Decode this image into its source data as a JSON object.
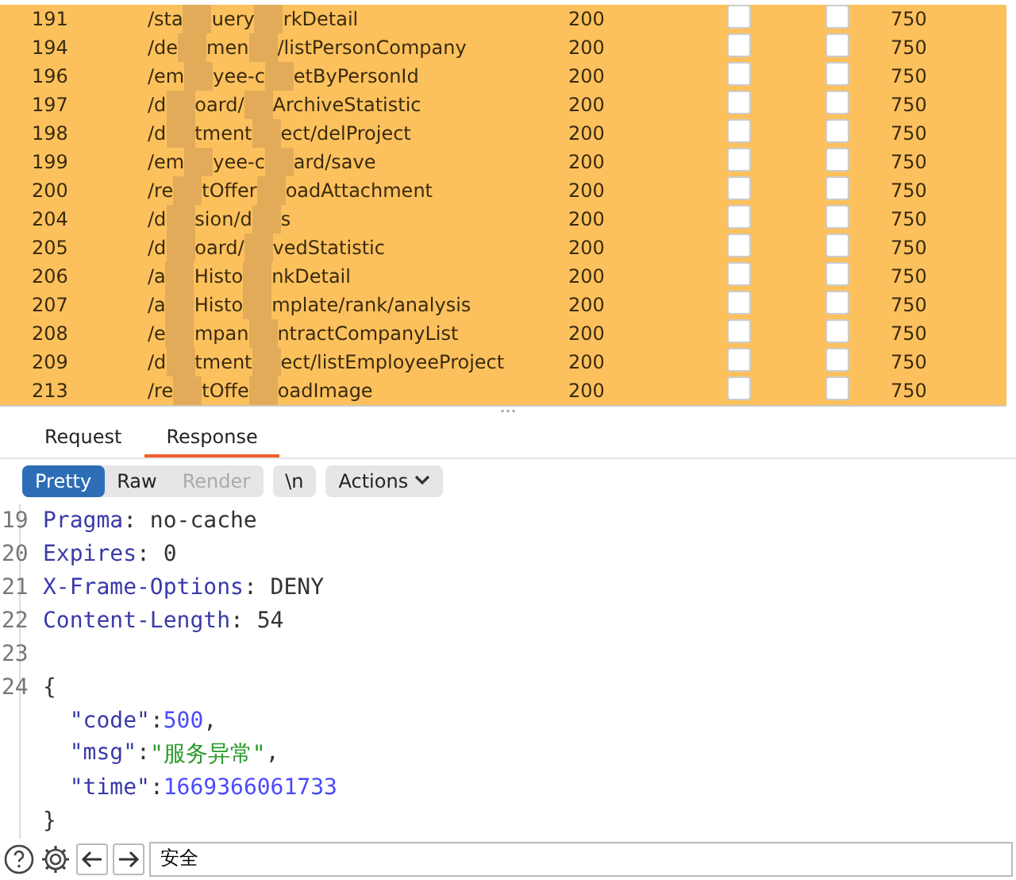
{
  "table": {
    "rows": [
      {
        "number": "191",
        "path": [
          "/sta",
          "uery",
          "rkDetail"
        ],
        "status": "200",
        "check_1": false,
        "check_2": false,
        "length": "750"
      },
      {
        "number": "194",
        "path": [
          "/de",
          "men",
          "/listPersonCompany"
        ],
        "status": "200",
        "check_1": false,
        "check_2": false,
        "length": "750"
      },
      {
        "number": "196",
        "path": [
          "/em",
          "yee-c",
          "etByPersonId"
        ],
        "status": "200",
        "check_1": false,
        "check_2": false,
        "length": "750"
      },
      {
        "number": "197",
        "path": [
          "/d",
          "oard/",
          "ArchiveStatistic"
        ],
        "status": "200",
        "check_1": false,
        "check_2": false,
        "length": "750"
      },
      {
        "number": "198",
        "path": [
          "/d",
          "tment",
          "ect/delProject"
        ],
        "status": "200",
        "check_1": false,
        "check_2": false,
        "length": "750"
      },
      {
        "number": "199",
        "path": [
          "/em",
          "yee-c",
          "ard/save"
        ],
        "status": "200",
        "check_1": false,
        "check_2": false,
        "length": "750"
      },
      {
        "number": "200",
        "path": [
          "/re",
          "tOffer",
          "oadAttachment"
        ],
        "status": "200",
        "check_1": false,
        "check_2": false,
        "length": "750"
      },
      {
        "number": "204",
        "path": [
          "/d",
          "sion/d",
          "s"
        ],
        "status": "200",
        "check_1": false,
        "check_2": false,
        "length": "750"
      },
      {
        "number": "205",
        "path": [
          "/d",
          "oard/",
          "vedStatistic"
        ],
        "status": "200",
        "check_1": false,
        "check_2": false,
        "length": "750"
      },
      {
        "number": "206",
        "path": [
          "/a",
          "Histo",
          "nkDetail"
        ],
        "status": "200",
        "check_1": false,
        "check_2": false,
        "length": "750"
      },
      {
        "number": "207",
        "path": [
          "/a",
          "Histo",
          "mplate/rank/analysis"
        ],
        "status": "200",
        "check_1": false,
        "check_2": false,
        "length": "750"
      },
      {
        "number": "208",
        "path": [
          "/e",
          "mpan",
          "ntractCompanyList"
        ],
        "status": "200",
        "check_1": false,
        "check_2": false,
        "length": "750"
      },
      {
        "number": "209",
        "path": [
          "/d",
          "tment",
          "ect/listEmployeeProject"
        ],
        "status": "200",
        "check_1": false,
        "check_2": false,
        "length": "750"
      },
      {
        "number": "213",
        "path": [
          "/re",
          "tOffe",
          "oadImage"
        ],
        "status": "200",
        "check_1": false,
        "check_2": false,
        "length": "750"
      }
    ]
  },
  "splitter": "•••",
  "tabs": [
    {
      "label": "Request",
      "selected": false
    },
    {
      "label": "Response",
      "selected": true
    }
  ],
  "view_buttons": [
    {
      "label": "Pretty",
      "selected": true,
      "disabled": false
    },
    {
      "label": "Raw",
      "selected": false,
      "disabled": false
    },
    {
      "label": "Render",
      "selected": false,
      "disabled": true
    }
  ],
  "newline_button": "\\n",
  "actions_button": "Actions",
  "code_lines": [
    {
      "number": "19",
      "tokens": [
        {
          "kind": "key",
          "text": "Pragma"
        },
        {
          "kind": "plain",
          "text": ": no-cache"
        }
      ]
    },
    {
      "number": "20",
      "tokens": [
        {
          "kind": "key",
          "text": "Expires"
        },
        {
          "kind": "plain",
          "text": ": 0"
        }
      ]
    },
    {
      "number": "21",
      "tokens": [
        {
          "kind": "key",
          "text": "X-Frame-Options"
        },
        {
          "kind": "plain",
          "text": ": DENY"
        }
      ]
    },
    {
      "number": "22",
      "tokens": [
        {
          "kind": "key",
          "text": "Content-Length"
        },
        {
          "kind": "plain",
          "text": ": 54"
        }
      ]
    },
    {
      "number": "23"
    },
    {
      "number": "24",
      "tokens": [
        {
          "kind": "plain",
          "text": "{"
        }
      ]
    },
    {
      "tokens": [
        {
          "kind": "key",
          "text": "  \"code\""
        },
        {
          "kind": "plain",
          "text": ":"
        },
        {
          "kind": "number",
          "text": "500"
        },
        {
          "kind": "plain",
          "text": ","
        }
      ]
    },
    {
      "tokens": [
        {
          "kind": "key",
          "text": "  \"msg\""
        },
        {
          "kind": "plain",
          "text": ":"
        },
        {
          "kind": "string",
          "text": "\"服务异常\""
        },
        {
          "kind": "plain",
          "text": ","
        }
      ]
    },
    {
      "tokens": [
        {
          "kind": "key",
          "text": "  \"time\""
        },
        {
          "kind": "plain",
          "text": ":"
        },
        {
          "kind": "number",
          "text": "1669366061733"
        }
      ]
    },
    {
      "tokens": [
        {
          "kind": "plain",
          "text": "}"
        }
      ]
    }
  ],
  "search": {
    "value": "安全"
  }
}
